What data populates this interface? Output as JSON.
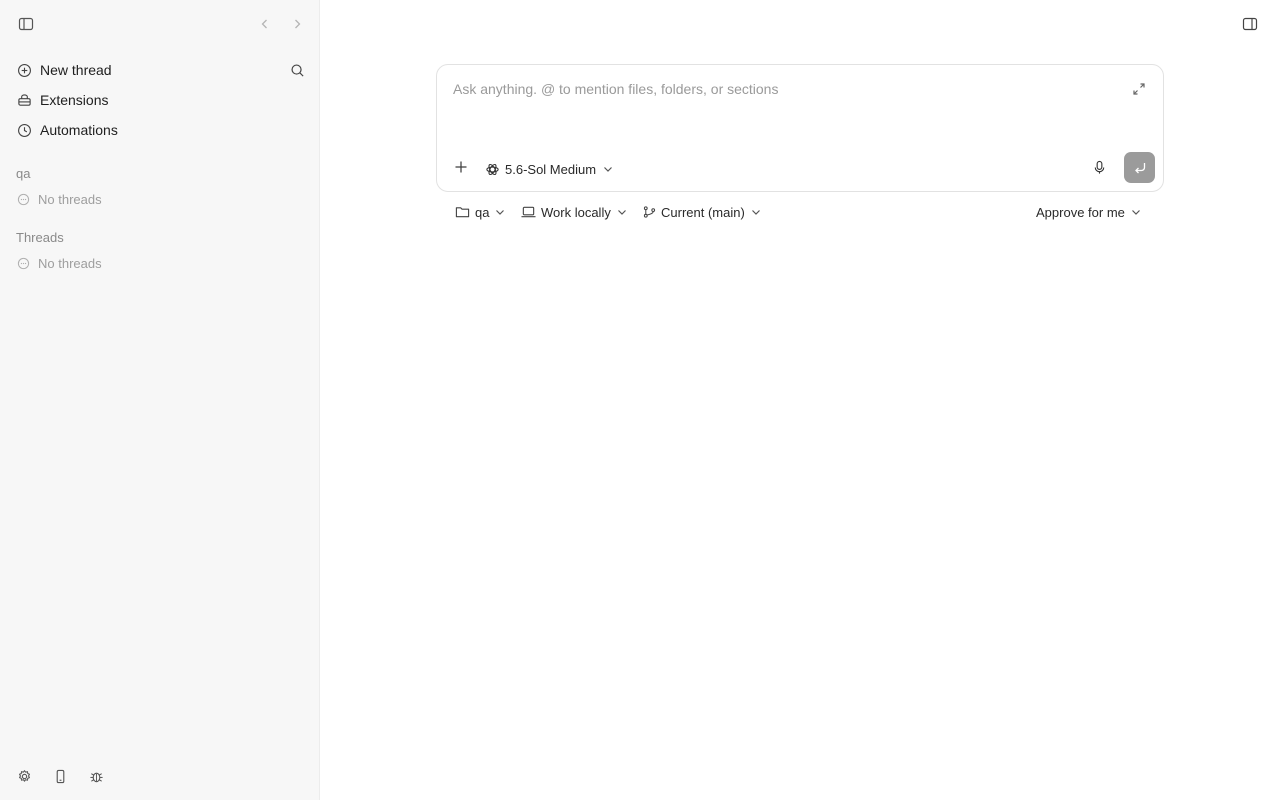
{
  "sidebar": {
    "nav": [
      {
        "label": "New thread",
        "icon": "plus-circle-icon"
      },
      {
        "label": "Extensions",
        "icon": "extensions-icon"
      },
      {
        "label": "Automations",
        "icon": "clock-icon"
      }
    ],
    "sections": [
      {
        "title": "qa",
        "empty_text": "No threads"
      },
      {
        "title": "Threads",
        "empty_text": "No threads"
      }
    ]
  },
  "composer": {
    "placeholder": "Ask anything. @ to mention files, folders, or sections",
    "model_label": "5.6-Sol Medium"
  },
  "toolbar": {
    "project_label": "qa",
    "environment_label": "Work locally",
    "branch_label": "Current (main)",
    "approval_label": "Approve for me"
  },
  "colors": {
    "sidebar_bg": "#f7f7f7",
    "send_button_bg": "#9b9b9b",
    "muted_text": "#9e9e9e"
  }
}
